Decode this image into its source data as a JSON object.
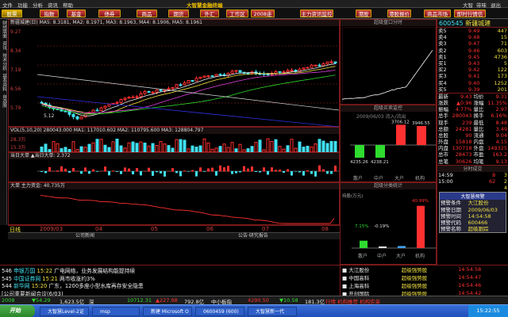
{
  "menu": {
    "items": [
      "文件",
      "功能",
      "分析",
      "资讯",
      "帮助"
    ],
    "app_title": "大智慧金融终端",
    "right": [
      "大智",
      "带味",
      "退出"
    ]
  },
  "toolbar": {
    "buttons": [
      "股票",
      "指数",
      "基金",
      "债券",
      "商品",
      "期货",
      "外汇",
      "工作区",
      "2008走势",
      "主力资讯监控",
      "港股",
      "港股报价",
      "商品市场",
      "即时行情信息"
    ]
  },
  "lefttabs": [
    "财经版面",
    "资讯",
    "技术分析",
    "基本资料",
    "自选股"
  ],
  "main_chart": {
    "header": "新疆城建(日) MA5: 8.3181, MA2: 8.1971, MA3: 8.1963, MA4: 8.1906, MA5: 8.1961",
    "y_labels": [
      "9.27",
      "8.34",
      "7.19",
      "6.56",
      "5.79",
      "-5.12"
    ],
    "low_label": "5.12"
  },
  "vol_chart": {
    "header": "VOL(5,10,20) 280043.000 MA1: 117010.602 MA2: 110795.600 MA3: 128804.797",
    "y_labels": [
      "28.3万",
      "15.3万",
      "7.71万"
    ],
    "indicator_header": "当日大单 ▲当日大单: 2.372",
    "flow_header": "大单 主力资金: 40.735万"
  },
  "x_axis": [
    "2009/03",
    "04",
    "05",
    "06",
    "07",
    "08"
  ],
  "bottom_tabs": [
    "日线",
    "公司新闻",
    "公告·研究报告"
  ],
  "panels": {
    "intraday_title": "超级盘口分时",
    "volume_title": "超级买卖监控",
    "volume_sub": "2009/06/03 流入/流出",
    "volume_values": [
      "4235.26",
      "4238.21",
      "3706.12",
      "3946.55"
    ],
    "volume_cats": [
      "散户",
      "中户",
      "大户",
      "机构"
    ],
    "capital_title": "超级分类统计",
    "capital_values": [
      "7.15%",
      "-0.19%",
      "40.99%"
    ],
    "capital_cats": [
      "散户",
      "中户",
      "大户",
      "机构"
    ],
    "capital_label": "持股(万元)"
  },
  "quote": {
    "code": "600545",
    "name": "新疆城建",
    "sell": [
      [
        "5",
        "9.49",
        "447"
      ],
      [
        "4",
        "9.48",
        "15"
      ],
      [
        "3",
        "9.47",
        "71"
      ],
      [
        "2",
        "9.46",
        "603"
      ],
      [
        "1",
        "9.45",
        "4736"
      ]
    ],
    "buy": [
      [
        "1",
        "9.43",
        "5"
      ],
      [
        "2",
        "9.42",
        "122"
      ],
      [
        "3",
        "9.41",
        "173"
      ],
      [
        "4",
        "9.40",
        "1252"
      ],
      [
        "5",
        "9.39",
        "201"
      ]
    ],
    "stats": [
      [
        "最新",
        "9.43",
        "均价",
        "9.31"
      ],
      [
        "涨跌",
        "▲0.96",
        "涨幅",
        "11.35%"
      ],
      [
        "振幅",
        "4.77%",
        "量比",
        "2.97"
      ],
      [
        "总手",
        "280043",
        "换手",
        "6.16%"
      ],
      [
        "现手",
        "239",
        "最低",
        "8.48"
      ],
      [
        "总额",
        "24281",
        "量比",
        "3.49"
      ],
      [
        "总股",
        "90",
        "流通",
        "9.04"
      ],
      [
        "外盘",
        "15818",
        "内盘",
        "4.15"
      ],
      [
        "内盘",
        "130718",
        "外盘",
        "149325"
      ],
      [
        "总市",
        "28473",
        "市盈",
        "163.2"
      ],
      [
        "总笔",
        "30626",
        "均笔",
        "9.13"
      ]
    ],
    "time_hdr": "分时成交",
    "ticks": [
      [
        "14:59",
        "8",
        "3"
      ],
      [
        "15:00",
        "62",
        "2"
      ],
      [
        "",
        "",
        "4"
      ]
    ],
    "alert_title": "大智慧预警",
    "alerts": [
      [
        "预警条件",
        "大江股份"
      ],
      [
        "预警日期",
        "2009/06/03"
      ],
      [
        "预警时间",
        "14:54:58"
      ],
      [
        "预警代码",
        "600466"
      ],
      [
        "预警名称",
        "超级跟踪"
      ]
    ]
  },
  "news": [
    {
      "id": "546",
      "src": "申银万国",
      "time": "15:22",
      "text": "广电网络，业务发展结构能提持续"
    },
    {
      "id": "545",
      "src": "中国证券网",
      "time": "15:21",
      "text": "两市收涨约3%"
    },
    {
      "id": "544",
      "src": "新华网",
      "time": "15:20",
      "text": "广东，1200多座小型水库再存安全隐患"
    },
    {
      "id": "",
      "src": "",
      "time": "",
      "text": "[公司重要新闻会议(6/03)"
    }
  ],
  "alert_list": {
    "items": [
      [
        "大江股份",
        "超级强势股",
        "14:54:58"
      ],
      [
        "中国高科",
        "超级强势股",
        "14:54:47"
      ],
      [
        "上海高科",
        "超级强势股",
        "14:54:46"
      ],
      [
        "开创国际",
        "超级强势股",
        "14:54:42"
      ]
    ]
  },
  "status": {
    "items": [
      {
        "t": "2008",
        "c": "grn"
      },
      {
        "t": "▼54.29",
        "c": "grn"
      },
      {
        "t": "1,623.5亿",
        "c": "wht"
      },
      {
        "t": "深",
        "c": "wht"
      },
      {
        "t": "10712.31",
        "c": "grn"
      },
      {
        "t": "▲227.98",
        "c": "red"
      },
      {
        "t": "792.8亿",
        "c": "wht"
      },
      {
        "t": "中小板指",
        "c": "wht"
      },
      {
        "t": "4290.50",
        "c": "red"
      },
      {
        "t": "▼10.58",
        "c": "grn"
      },
      {
        "t": "181.3亿",
        "c": "wht"
      },
      {
        "t": "行情 机构推荐 机构实单",
        "c": "red"
      }
    ]
  },
  "taskbar": {
    "start": "开始",
    "items": [
      "大智慧Level-2证",
      "msp",
      "新建 Microsoft O",
      "0600459 (600)",
      "大智慧新一代"
    ],
    "clock": "15:22:55"
  },
  "colors": {
    "up": "#ff3030",
    "down": "#2fdc2f",
    "bg": "#000000",
    "grid": "#7a1a1a"
  }
}
